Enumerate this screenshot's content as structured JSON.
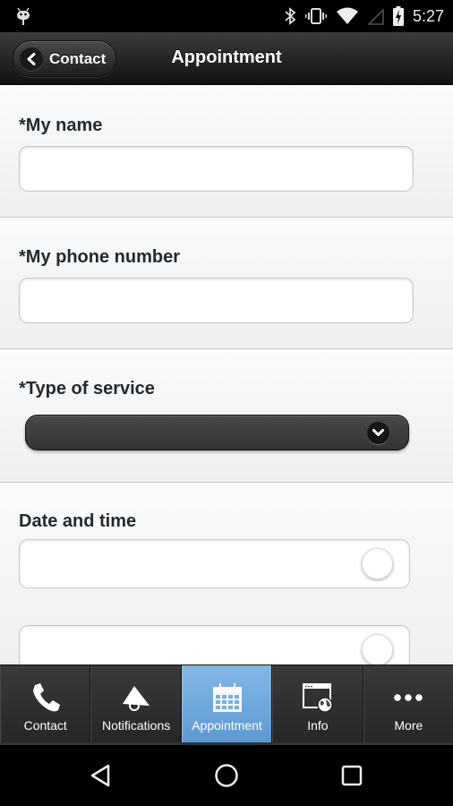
{
  "status_bar": {
    "time": "5:27",
    "icons": [
      "android-debug-icon",
      "bluetooth-icon",
      "vibrate-icon",
      "wifi-icon",
      "cell-signal-icon",
      "battery-charging-icon"
    ]
  },
  "header": {
    "back_label": "Contact",
    "back_icon": "chevron-left-icon",
    "title": "Appointment"
  },
  "form": {
    "name": {
      "label": "*My name",
      "value": "",
      "placeholder": ""
    },
    "phone": {
      "label": "*My phone number",
      "value": "",
      "placeholder": ""
    },
    "service": {
      "label": "*Type of service",
      "selected": "",
      "icon": "chevron-down-icon"
    },
    "datetime": {
      "label": "Date and time",
      "date_value": "",
      "time_value": ""
    }
  },
  "tabbar": {
    "active": "Appointment",
    "accent_color": "#6aa6dc",
    "tabs": [
      {
        "label": "Contact",
        "icon": "phone-icon"
      },
      {
        "label": "Notifications",
        "icon": "megaphone-icon"
      },
      {
        "label": "Appointment",
        "icon": "calendar-icon"
      },
      {
        "label": "Info",
        "icon": "web-globe-icon"
      },
      {
        "label": "More",
        "icon": "more-dots-icon"
      }
    ]
  },
  "navbar": {
    "buttons": [
      "back-icon",
      "home-icon",
      "recents-icon"
    ]
  }
}
